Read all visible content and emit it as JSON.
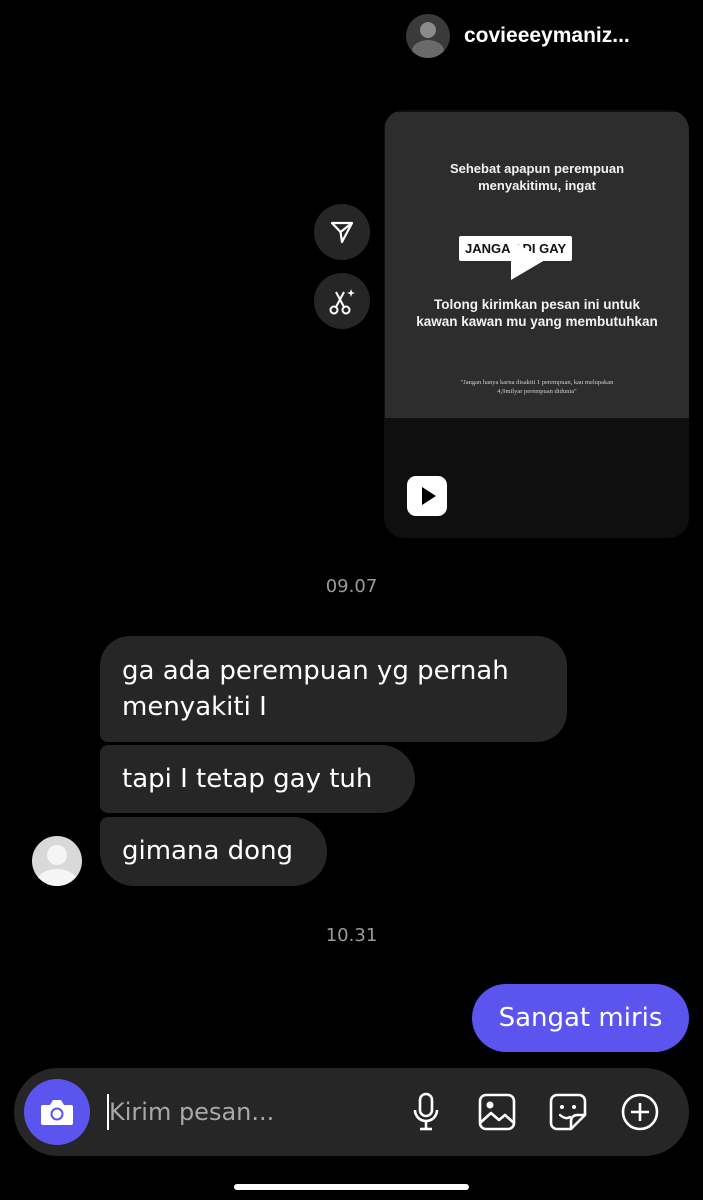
{
  "shared_post": {
    "username": "covieeeymaniz...",
    "caption_top": [
      "Sehebat apapun perempuan",
      "menyakitimu, ingat"
    ],
    "caption_highlight": "JANGA  ADI GAY",
    "caption_bottom": [
      "Tolong kirimkan pesan ini untuk",
      "kawan kawan mu yang membutuhkan"
    ],
    "caption_small": [
      "\"Jangan hanya karna disakiti 1 perempuan, kau melupakan",
      "4,9milyar perempuan didunia\""
    ]
  },
  "messages": [
    {
      "type": "timestamp",
      "text": "09.07"
    },
    {
      "type": "incoming",
      "text": "ga ada perempuan yg pernah menyakiti I"
    },
    {
      "type": "incoming",
      "text": "tapi I tetap gay tuh"
    },
    {
      "type": "incoming",
      "text": "gimana dong"
    },
    {
      "type": "timestamp",
      "text": "10.31"
    },
    {
      "type": "outgoing",
      "text": "Sangat miris"
    }
  ],
  "composer": {
    "placeholder": "Kirim pesan...",
    "icons": [
      "camera-icon",
      "microphone-icon",
      "image-icon",
      "sticker-icon",
      "plus-icon"
    ]
  },
  "side_actions": [
    "share-icon",
    "ai-edit-icon"
  ],
  "colors": {
    "accent": "#5b54ee",
    "bubble": "#262626",
    "background": "#000000"
  }
}
